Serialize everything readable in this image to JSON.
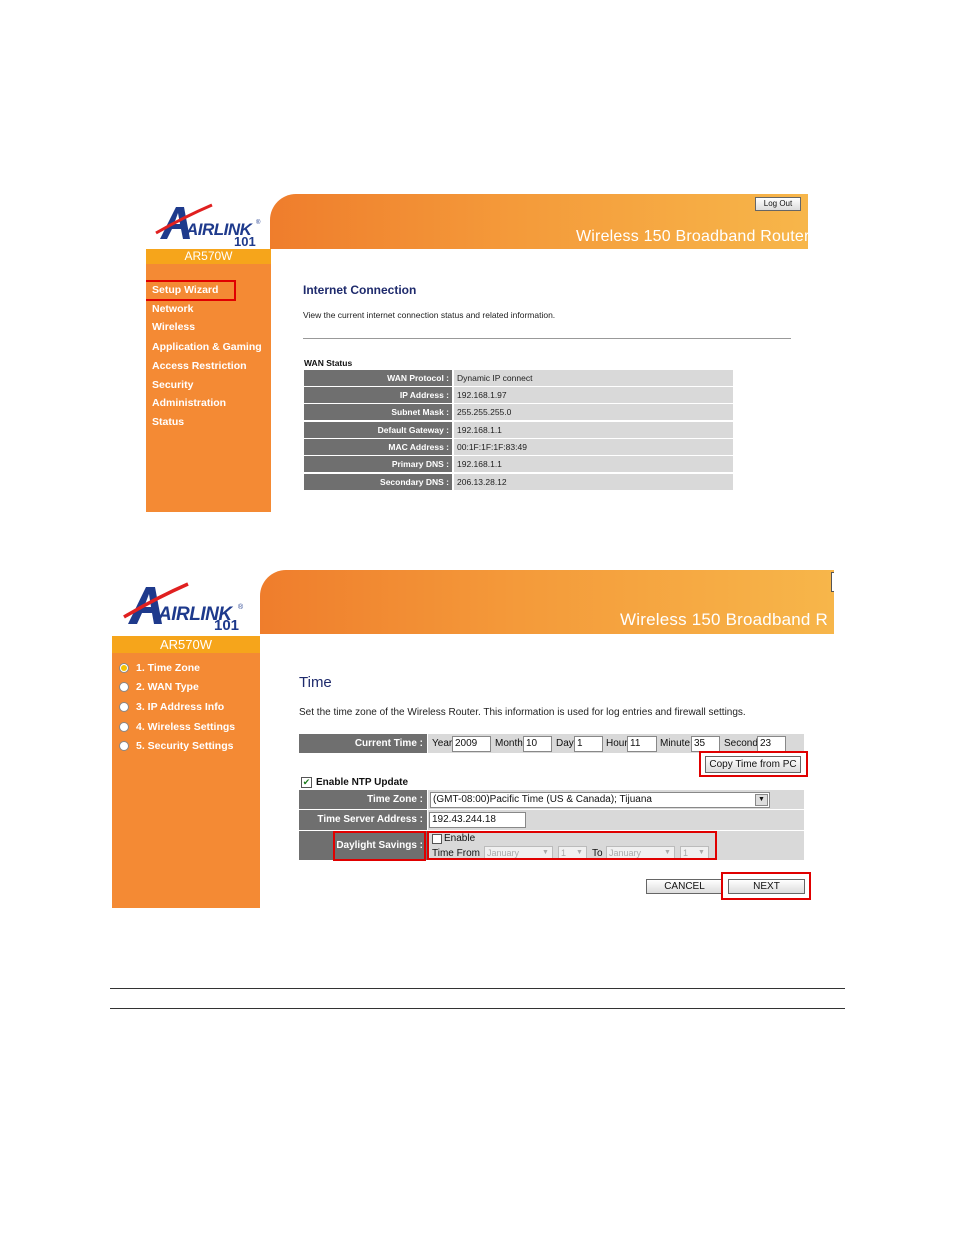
{
  "screenshot1": {
    "logo": {
      "brand_text": "AIRLINK",
      "number": "101",
      "registered": "®"
    },
    "model": "AR570W",
    "banner_title": "Wireless 150 Broadband Router",
    "logout_label": "Log Out",
    "nav": [
      "Setup Wizard",
      "Network",
      "Wireless",
      "Application & Gaming",
      "Access Restriction",
      "Security",
      "Administration",
      "Status"
    ],
    "page_title": "Internet Connection",
    "description": "View the current internet connection status and related information.",
    "section_title": "WAN Status",
    "wan_rows": [
      {
        "label": "WAN Protocol :",
        "value": "Dynamic IP connect"
      },
      {
        "label": "IP Address :",
        "value": "192.168.1.97"
      },
      {
        "label": "Subnet Mask :",
        "value": "255.255.255.0"
      },
      {
        "label": "Default Gateway :",
        "value": "192.168.1.1"
      },
      {
        "label": "MAC Address :",
        "value": "00:1F:1F:1F:83:49"
      },
      {
        "label": "Primary DNS :",
        "value": "192.168.1.1"
      },
      {
        "label": "Secondary DNS :",
        "value": "206.13.28.12"
      }
    ]
  },
  "screenshot2": {
    "logo": {
      "brand_text": "AIRLINK",
      "number": "101",
      "registered": "®"
    },
    "model": "AR570W",
    "banner_title": "Wireless 150 Broadband R",
    "steps": [
      "1. Time Zone",
      "2. WAN Type",
      "3. IP Address Info",
      "4. Wireless Settings",
      "5. Security Settings"
    ],
    "page_title": "Time",
    "description": "Set the time zone of the Wireless Router. This information is used for log entries and firewall settings.",
    "current_time": {
      "label": "Current Time :",
      "year_label": "Year",
      "year": "2009",
      "month_label": "Month",
      "month": "10",
      "day_label": "Day",
      "day": "1",
      "hour_label": "Hour",
      "hour": "11",
      "minute_label": "Minute",
      "minute": "35",
      "second_label": "Second",
      "second": "23"
    },
    "copy_time_label": "Copy Time from PC",
    "ntp_label": "Enable NTP Update",
    "time_zone_label": "Time Zone :",
    "time_zone_value": "(GMT-08:00)Pacific Time (US & Canada); Tijuana",
    "time_server_label": "Time Server Address :",
    "time_server_value": "192.43.244.18",
    "daylight_label": "Daylight Savings :",
    "dst_enable_label": "Enable",
    "dst_time_from_label": "Time From",
    "dst_to_label": "To",
    "dst_from_month": "January",
    "dst_from_day": "1",
    "dst_to_month": "January",
    "dst_to_day": "1",
    "cancel_label": "CANCEL",
    "next_label": "NEXT"
  },
  "colors": {
    "accent_orange": "#f48a34",
    "banner_orange": "#f49a3a",
    "highlight_red": "#e00000",
    "label_gray": "#6f6f6f",
    "navy": "#1e2a6c"
  }
}
